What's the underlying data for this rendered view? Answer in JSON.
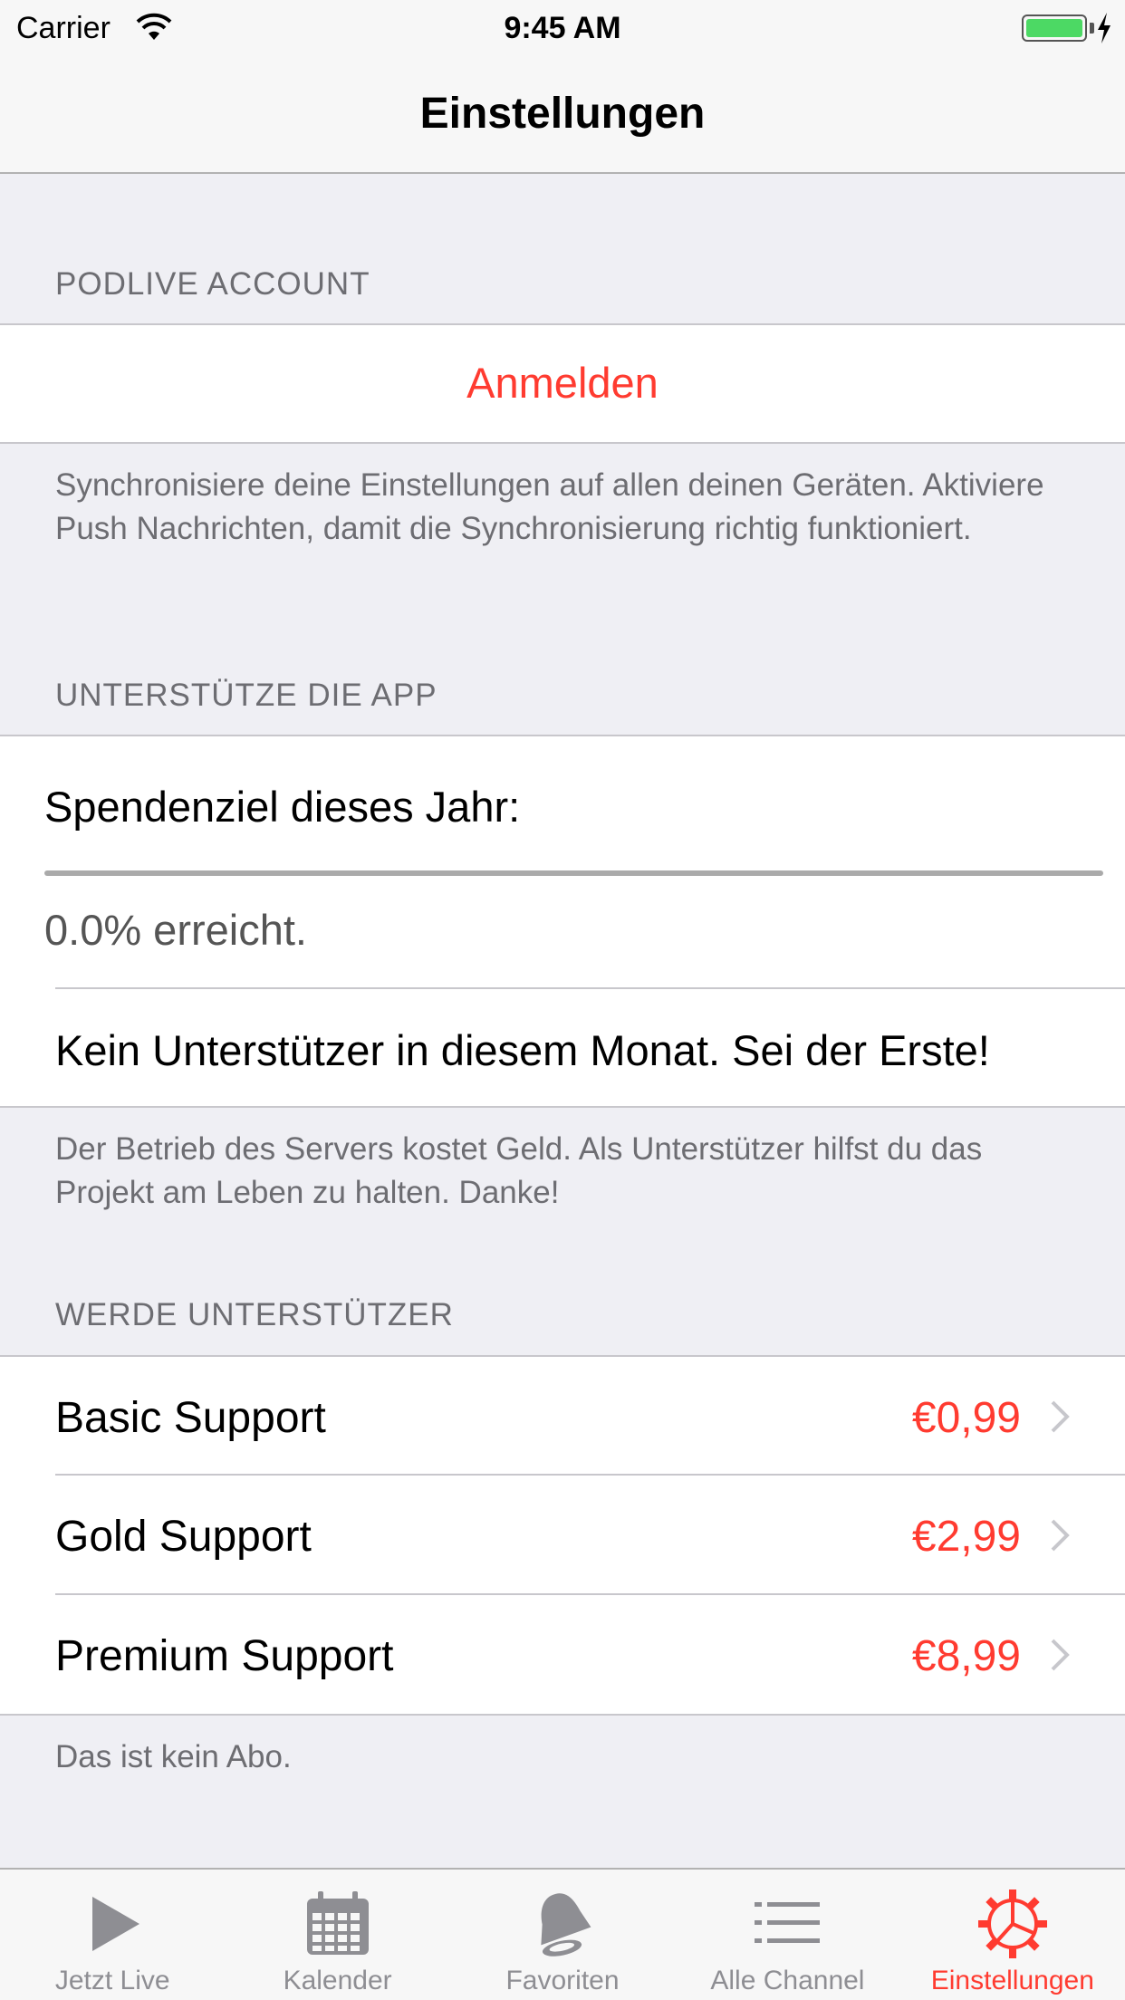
{
  "status_bar": {
    "carrier": "Carrier",
    "time": "9:45 AM"
  },
  "nav": {
    "title": "Einstellungen"
  },
  "account": {
    "header": "PODLIVE ACCOUNT",
    "login_label": "Anmelden",
    "footer": "Synchronisiere deine Einstellungen auf allen deinen Geräten. Aktiviere Push Nachrichten, damit die Synchronisierung richtig funktioniert."
  },
  "support_app": {
    "header": "UNTERSTÜTZE DIE APP",
    "goal_title": "Spendenziel dieses Jahr:",
    "progress_fraction": 0.0,
    "progress_text": "0.0% erreicht.",
    "supporter_text": "Kein Unterstützer in diesem Monat. Sei der Erste!",
    "footer": "Der Betrieb des Servers kostet Geld. Als Unterstützer hilfst du das Projekt am Leben zu halten. Danke!"
  },
  "become_supporter": {
    "header": "WERDE UNTERSTÜTZER",
    "tiers": [
      {
        "label": "Basic Support",
        "price": "€0,99"
      },
      {
        "label": "Gold Support",
        "price": "€2,99"
      },
      {
        "label": "Premium Support",
        "price": "€8,99"
      }
    ],
    "footer": "Das ist kein Abo."
  },
  "tabs": [
    {
      "label": "Jetzt Live",
      "icon": "play-icon",
      "active": false
    },
    {
      "label": "Kalender",
      "icon": "calendar-icon",
      "active": false
    },
    {
      "label": "Favoriten",
      "icon": "bell-icon",
      "active": false
    },
    {
      "label": "Alle Channel",
      "icon": "list-icon",
      "active": false
    },
    {
      "label": "Einstellungen",
      "icon": "gear-icon",
      "active": true
    }
  ],
  "colors": {
    "accent": "#ff3b30",
    "background": "#efeff4",
    "secondary_text": "#6d6d72",
    "inactive_tab": "#8e8e93"
  }
}
